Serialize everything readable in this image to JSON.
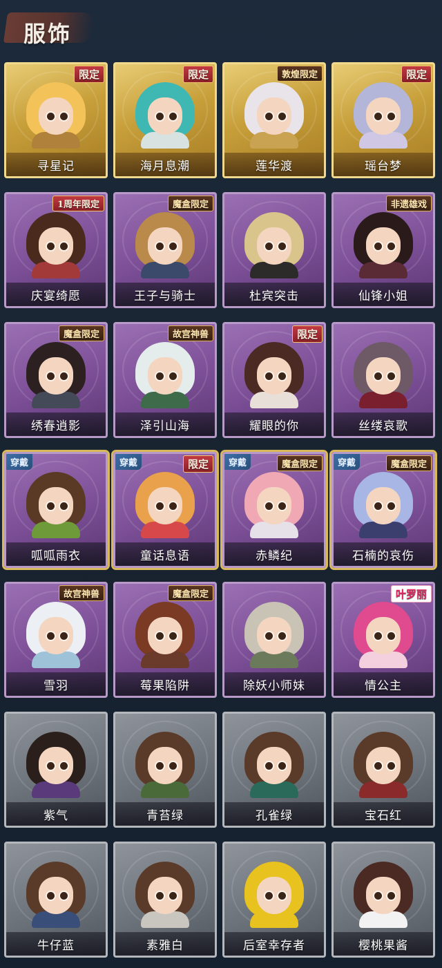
{
  "header": {
    "title": "服饰"
  },
  "cards": [
    {
      "name": "寻星记",
      "tier": "gold",
      "tag": "限定",
      "worn": false,
      "hair": "#f3c35a",
      "outfit": "#b0813a"
    },
    {
      "name": "海月息潮",
      "tier": "gold",
      "tag": "限定",
      "worn": false,
      "hair": "#3fb8b3",
      "outfit": "#d8e2e0"
    },
    {
      "name": "莲华渡",
      "tier": "gold",
      "tag": "敦煌限定",
      "worn": false,
      "hair": "#e8e4ea",
      "outfit": "#c9a352"
    },
    {
      "name": "瑶台梦",
      "tier": "gold",
      "tag": "限定",
      "worn": false,
      "hair": "#b3b6d8",
      "outfit": "#cfc7e4"
    },
    {
      "name": "庆宴绮愿",
      "tier": "purple",
      "tag": "1周年限定",
      "worn": false,
      "hair": "#4a2a1d",
      "outfit": "#a33a3a"
    },
    {
      "name": "王子与骑士",
      "tier": "purple",
      "tag": "魔盒限定",
      "worn": false,
      "hair": "#b98a4a",
      "outfit": "#3b4a6b"
    },
    {
      "name": "杜宾突击",
      "tier": "purple",
      "tag": "",
      "worn": false,
      "hair": "#d9c58c",
      "outfit": "#2d2a2a"
    },
    {
      "name": "仙锋小姐",
      "tier": "purple",
      "tag": "非遗雄戏",
      "worn": false,
      "hair": "#2a1a1a",
      "outfit": "#5a2a35"
    },
    {
      "name": "绣春逍影",
      "tier": "purple",
      "tag": "魔盒限定",
      "worn": false,
      "hair": "#2c2020",
      "outfit": "#444a58"
    },
    {
      "name": "泽引山海",
      "tier": "purple",
      "tag": "故宫神兽",
      "worn": false,
      "hair": "#e5ecec",
      "outfit": "#3e6b4a"
    },
    {
      "name": "耀眼的你",
      "tier": "purple",
      "tag": "限定",
      "worn": false,
      "hair": "#4a2a22",
      "outfit": "#e8e0d8"
    },
    {
      "name": "丝缕哀歌",
      "tier": "purple",
      "tag": "",
      "worn": false,
      "hair": "#6d5a66",
      "outfit": "#7a1f2e"
    },
    {
      "name": "呱呱雨衣",
      "tier": "purple",
      "tag": "",
      "worn": true,
      "hair": "#5a3a24",
      "outfit": "#6e9a3a"
    },
    {
      "name": "童话息语",
      "tier": "purple",
      "tag": "限定",
      "worn": true,
      "hair": "#e9a14c",
      "outfit": "#d6484a"
    },
    {
      "name": "赤鳞纪",
      "tier": "purple",
      "tag": "魔盒限定",
      "worn": true,
      "hair": "#f0a9b4",
      "outfit": "#e6e0e8"
    },
    {
      "name": "石楠的哀伤",
      "tier": "purple",
      "tag": "魔盒限定",
      "worn": true,
      "hair": "#a8b6e6",
      "outfit": "#3a3f6e"
    },
    {
      "name": "雪羽",
      "tier": "purple",
      "tag": "故宫神兽",
      "worn": false,
      "hair": "#ecf0f4",
      "outfit": "#9ec2d8"
    },
    {
      "name": "莓果陷阱",
      "tier": "purple",
      "tag": "魔盒限定",
      "worn": false,
      "hair": "#7a3a24",
      "outfit": "#6a3a2a"
    },
    {
      "name": "除妖小师妹",
      "tier": "purple",
      "tag": "",
      "worn": false,
      "hair": "#c9c3b6",
      "outfit": "#6b7a5a"
    },
    {
      "name": "情公主",
      "tier": "purple",
      "tag": "叶罗丽",
      "worn": false,
      "hair": "#e04a8f",
      "outfit": "#f4d0de"
    },
    {
      "name": "紫气",
      "tier": "gray",
      "tag": "",
      "worn": false,
      "hair": "#2a1f1a",
      "outfit": "#5a3a7a"
    },
    {
      "name": "青苔绿",
      "tier": "gray",
      "tag": "",
      "worn": false,
      "hair": "#5a3a28",
      "outfit": "#4a6a3a"
    },
    {
      "name": "孔雀绿",
      "tier": "gray",
      "tag": "",
      "worn": false,
      "hair": "#5a3a28",
      "outfit": "#2a6a5a"
    },
    {
      "name": "宝石红",
      "tier": "gray",
      "tag": "",
      "worn": false,
      "hair": "#5a3a28",
      "outfit": "#8a2a2a"
    },
    {
      "name": "牛仔蓝",
      "tier": "gray",
      "tag": "",
      "worn": false,
      "hair": "#5a3a28",
      "outfit": "#3a4e7a"
    },
    {
      "name": "素雅白",
      "tier": "gray",
      "tag": "",
      "worn": false,
      "hair": "#5a3a28",
      "outfit": "#c9c6c0"
    },
    {
      "name": "后室幸存者",
      "tier": "gray",
      "tag": "",
      "worn": false,
      "hair": "#e8c21e",
      "outfit": "#e8c21e"
    },
    {
      "name": "樱桃果酱",
      "tier": "gray",
      "tag": "",
      "worn": false,
      "hair": "#4a2a22",
      "outfit": "#f2f2f2"
    }
  ],
  "labels": {
    "worn": "穿戴"
  },
  "colors": {
    "page_bg": "#182535",
    "gold_frame": "#c79f3a",
    "purple_frame": "#7b4e96",
    "gray_frame": "#6d737b",
    "limited_tag": "#c23a42",
    "worn_tag": "#3c6fa8"
  }
}
